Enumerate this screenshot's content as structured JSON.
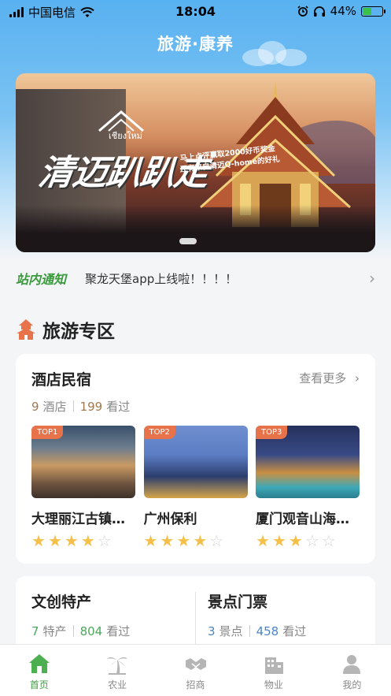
{
  "status_bar": {
    "carrier": "中国电信",
    "time": "18:04",
    "battery": "44%",
    "battery_level": 0.44
  },
  "app": {
    "title": "旅游·康养"
  },
  "banner": {
    "logo_text": "เชียงใหม่",
    "headline": "清迈趴趴走",
    "sub_line1": "马上点评赢取2000好币奖金",
    "sub_line2": "还有来自清迈Q-home的好礼"
  },
  "notice": {
    "tag": "站内通知",
    "text": "聚龙天堡app上线啦！！！！"
  },
  "section": {
    "title": "旅游专区"
  },
  "hotels_card": {
    "title": "酒店民宿",
    "more": "查看更多",
    "count": "9",
    "count_unit": "酒店",
    "views": "199",
    "views_unit": "看过",
    "items": [
      {
        "badge": "TOP1",
        "name": "大理丽江古镇…",
        "rating": 4
      },
      {
        "badge": "TOP2",
        "name": "广州保利",
        "rating": 4
      },
      {
        "badge": "TOP3",
        "name": "厦门观音山海…",
        "rating": 3
      }
    ]
  },
  "culture_card": {
    "title": "文创特产",
    "count": "7",
    "count_unit": "特产",
    "views": "804",
    "views_unit": "看过",
    "count_color": "#4aa85a",
    "views_color": "#4aa85a"
  },
  "tickets_card": {
    "title": "景点门票",
    "count": "3",
    "count_unit": "景点",
    "views": "458",
    "views_unit": "看过",
    "count_color": "#4a86c8",
    "views_color": "#4a86c8"
  },
  "tabbar": {
    "items": [
      {
        "label": "首页",
        "icon": "home-icon",
        "active": true
      },
      {
        "label": "农业",
        "icon": "palm-tree-icon",
        "active": false
      },
      {
        "label": "招商",
        "icon": "handshake-icon",
        "active": false
      },
      {
        "label": "物业",
        "icon": "building-icon",
        "active": false
      },
      {
        "label": "我的",
        "icon": "user-icon",
        "active": false
      }
    ]
  },
  "colors": {
    "accent_green": "#3b9a3e",
    "header_blue": "#58b1f0",
    "star_on": "#f5c04a",
    "badge_orange": "#e8724a"
  }
}
